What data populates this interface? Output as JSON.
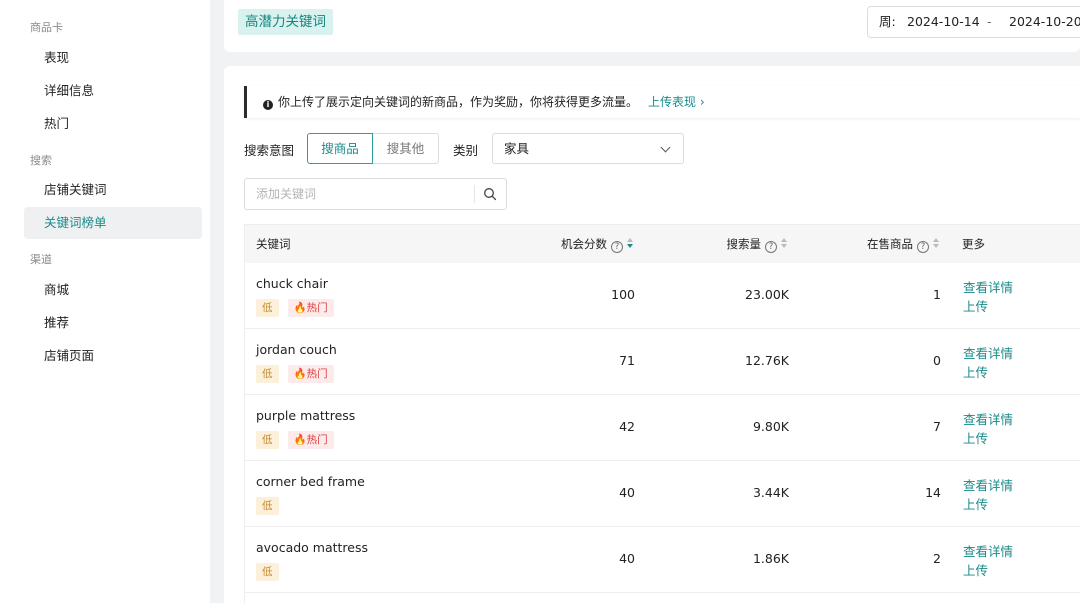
{
  "sidebar": {
    "sections": [
      {
        "label": "商品卡",
        "items": [
          {
            "label": "表现"
          },
          {
            "label": "详细信息"
          },
          {
            "label": "热门"
          }
        ]
      },
      {
        "label": "搜索",
        "items": [
          {
            "label": "店铺关键词"
          },
          {
            "label": "关键词榜单",
            "active": true
          }
        ]
      },
      {
        "label": "渠道",
        "items": [
          {
            "label": "商城"
          },
          {
            "label": "推荐"
          },
          {
            "label": "店铺页面"
          }
        ]
      }
    ]
  },
  "header": {
    "title": "高潜力关键词",
    "date_range": {
      "label": "周:",
      "start": "2024-10-14",
      "separator": "-",
      "end": "2024-10-20"
    }
  },
  "notice": {
    "text": "你上传了展示定向关键词的新商品，作为奖励，你将获得更多流量。",
    "link": "上传表现 ›"
  },
  "filters": {
    "intent_label": "搜索意图",
    "intent_options": [
      "搜商品",
      "搜其他"
    ],
    "category_label": "类别",
    "category_value": "家具",
    "search_placeholder": "添加关键词"
  },
  "table": {
    "headers": {
      "keyword": "关键词",
      "score": "机会分数",
      "volume": "搜索量",
      "stock": "在售商品",
      "more": "更多"
    },
    "rows": [
      {
        "keyword": "chuck chair",
        "level": "低",
        "hot": "热门",
        "score": "100",
        "volume": "23.00K",
        "stock": "1",
        "view": "查看详情",
        "upload": "上传"
      },
      {
        "keyword": "jordan couch",
        "level": "低",
        "hot": "热门",
        "score": "71",
        "volume": "12.76K",
        "stock": "0",
        "view": "查看详情",
        "upload": "上传"
      },
      {
        "keyword": "purple mattress",
        "level": "低",
        "hot": "热门",
        "score": "42",
        "volume": "9.80K",
        "stock": "7",
        "view": "查看详情",
        "upload": "上传"
      },
      {
        "keyword": "corner bed frame",
        "level": "低",
        "hot": null,
        "score": "40",
        "volume": "3.44K",
        "stock": "14",
        "view": "查看详情",
        "upload": "上传"
      },
      {
        "keyword": "avocado mattress",
        "level": "低",
        "hot": null,
        "score": "40",
        "volume": "1.86K",
        "stock": "2",
        "view": "查看详情",
        "upload": "上传"
      }
    ]
  },
  "colors": {
    "accent": "#1a8a8a",
    "hot": "#d94141",
    "low": "#c08a2c"
  }
}
